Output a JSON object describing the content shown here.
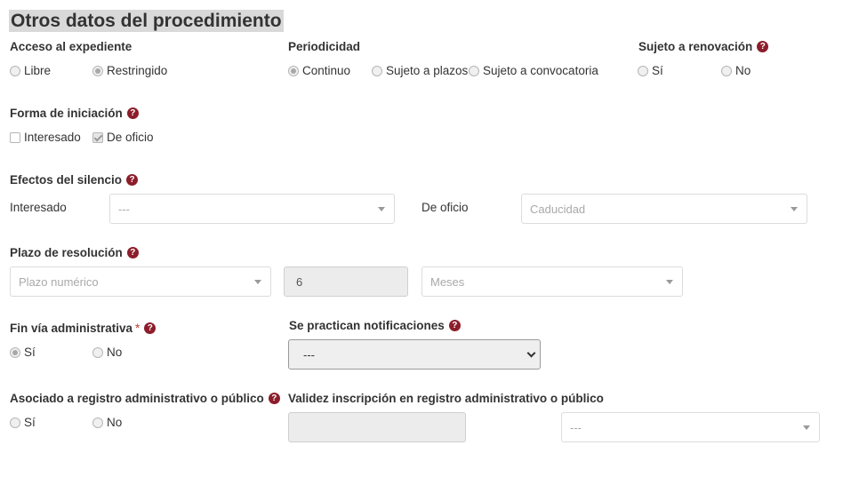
{
  "section_title": "Otros datos del procedimiento",
  "acceso": {
    "label": "Acceso al expediente",
    "options": [
      "Libre",
      "Restringido"
    ],
    "selected": "Restringido"
  },
  "periodicidad": {
    "label": "Periodicidad",
    "options": [
      "Continuo",
      "Sujeto a plazos",
      "Sujeto a convocatoria"
    ],
    "selected": "Continuo"
  },
  "renovacion": {
    "label": "Sujeto a renovación",
    "options": [
      "Sí",
      "No"
    ]
  },
  "forma_iniciacion": {
    "label": "Forma de iniciación",
    "options": [
      "Interesado",
      "De oficio"
    ],
    "checked": "De oficio"
  },
  "efectos_silencio": {
    "label": "Efectos del silencio",
    "interesado_label": "Interesado",
    "interesado_value": "---",
    "oficio_label": "De oficio",
    "oficio_value": "Caducidad"
  },
  "plazo_resolucion": {
    "label": "Plazo de resolución",
    "type_placeholder": "Plazo numérico",
    "number_value": "6",
    "unit_value": "Meses"
  },
  "fin_via": {
    "label": "Fin vía administrativa",
    "required_mark": "*",
    "options": [
      "Sí",
      "No"
    ],
    "selected": "Sí"
  },
  "notificaciones": {
    "label": "Se practican notificaciones",
    "value": "---"
  },
  "registro": {
    "label": "Asociado a registro administrativo o público",
    "options": [
      "Sí",
      "No"
    ]
  },
  "validez": {
    "label": "Validez inscripción en registro administrativo o público",
    "input_value": "",
    "select_value": "---"
  },
  "help_glyph": "?",
  "icons": {
    "help": "question-circle-icon",
    "caret": "caret-down-icon",
    "chevron": "chevron-down-icon"
  },
  "colors": {
    "help_icon": "#8c1d2a",
    "required_mark": "#c0392b",
    "title_highlight": "#d9d9d9"
  }
}
